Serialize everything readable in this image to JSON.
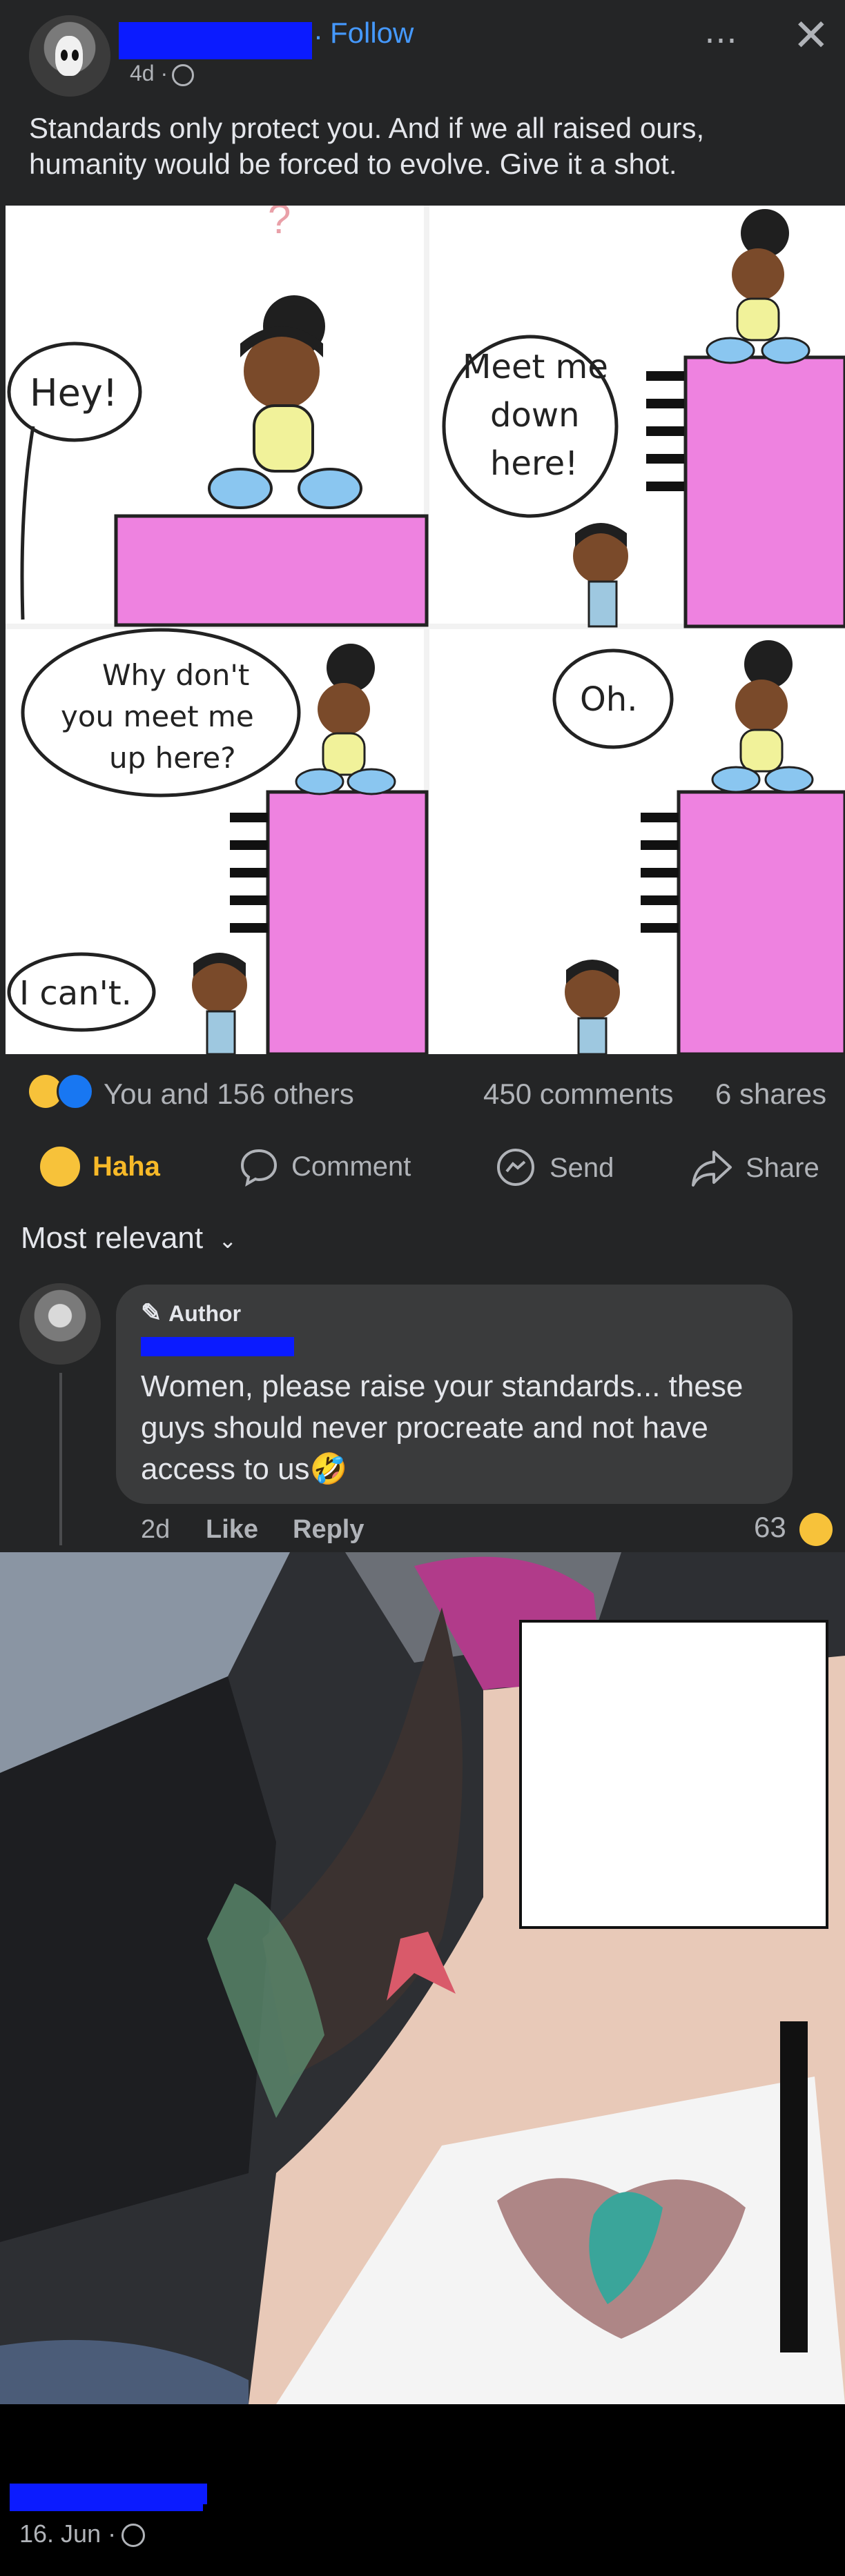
{
  "header": {
    "follow_label": "Follow",
    "separator": "·",
    "time_label": "4d ·",
    "more_icon": "⋯",
    "close_icon": "✕"
  },
  "post": {
    "caption": "Standards only protect you. And if we all raised ours, humanity would be forced to evolve. Give it a shot."
  },
  "comic": {
    "question_mark": "?",
    "panel1_speech": "Hey!",
    "panel2_speech_line1": "Meet me",
    "panel2_speech_line2": "down",
    "panel2_speech_line3": "here!",
    "panel3_speech_line1": "Why don't",
    "panel3_speech_line2": "you meet me",
    "panel3_speech_line3": "up here?",
    "panel3_reply": "I can't.",
    "panel4_speech": "Oh."
  },
  "stats": {
    "reactions_label": "You and 156 others",
    "comments_label": "450 comments",
    "shares_label": "6 shares"
  },
  "actions": {
    "haha_label": "Haha",
    "comment_label": "Comment",
    "send_label": "Send",
    "share_label": "Share"
  },
  "sort": {
    "label": "Most relevant",
    "chevron": "⌄"
  },
  "comment": {
    "badge_label": "Author",
    "text": "Women, please raise your standards... these guys should never procreate and not have access to us🤣",
    "time": "2d",
    "like_label": "Like",
    "reply_label": "Reply",
    "reaction_count": "63"
  },
  "footer": {
    "date_label": "16. Jun ·"
  },
  "colors": {
    "background": "#242526",
    "text_primary": "#e4e6eb",
    "text_secondary": "#b0b3b8",
    "link_blue": "#4599ff",
    "haha_yellow": "#f7b928",
    "comic_pink": "#ee82e0",
    "redaction_blue": "#0b1bff"
  }
}
